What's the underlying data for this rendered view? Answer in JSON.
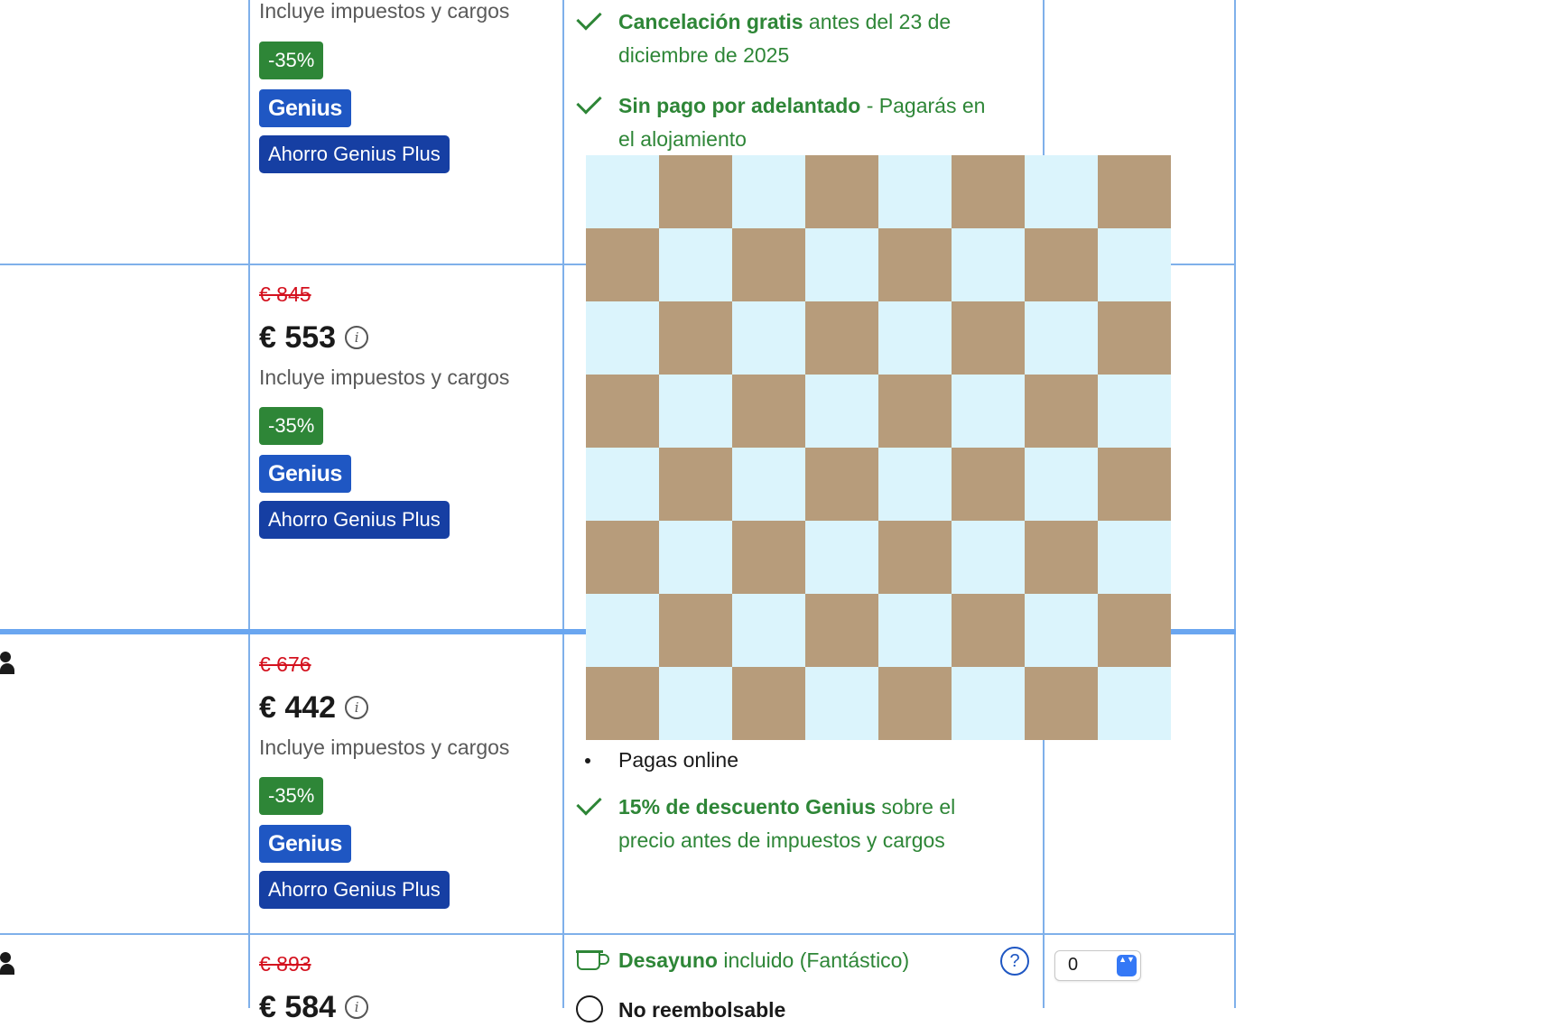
{
  "rows": [
    {
      "taxes": "Incluye impuestos y cargos",
      "discount": "-35%",
      "genius": "Genius",
      "genius_plus": "Ahorro Genius Plus",
      "conditions": {
        "cancel_bold": "Cancelación gratis",
        "cancel_rest": " antes del 23 de diciembre de 2025",
        "nopay_bold": "Sin pago por adelantado",
        "nopay_rest": " - Pagarás en el alojamiento"
      }
    },
    {
      "old_price": "€ 845",
      "price": "€ 553",
      "taxes": "Incluye impuestos y cargos",
      "discount": "-35%",
      "genius": "Genius",
      "genius_plus": "Ahorro Genius Plus"
    },
    {
      "old_price": "€ 676",
      "price": "€ 442",
      "taxes": "Incluye impuestos y cargos",
      "discount": "-35%",
      "genius": "Genius",
      "genius_plus": "Ahorro Genius Plus",
      "conditions": {
        "pay_online": "Pagas online",
        "genius_bold": "15% de descuento Genius",
        "genius_rest": " sobre el precio antes de impuestos y cargos"
      }
    },
    {
      "old_price": "€ 893",
      "price": "€ 584",
      "conditions": {
        "breakfast_bold": "Desayuno",
        "breakfast_rest": " incluido (Fantástico)",
        "nonrefund": "No reembolsable"
      },
      "help": "?",
      "quantity": "0"
    }
  ],
  "icons": {
    "info": "i",
    "select_arrows": "▲▼"
  },
  "colors": {
    "green": "#2e8637",
    "old_price_red": "#d4111e",
    "genius_blue": "#1f57c3",
    "genius_plus_blue": "#163fa3",
    "border_blue": "#7fb0ea",
    "checker_dark": "#b79c7b",
    "checker_light": "#dbf4fc"
  }
}
